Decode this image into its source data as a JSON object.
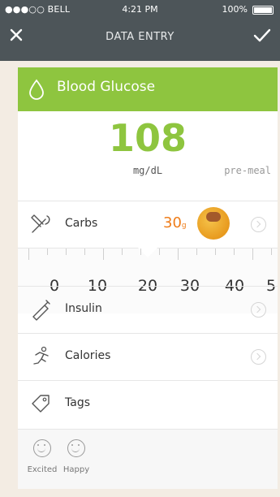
{
  "status": {
    "carrier": "●●●○○ BELL",
    "time": "4:21 PM",
    "battery": "100%"
  },
  "nav": {
    "title": "DATA ENTRY"
  },
  "glucose": {
    "title": "Blood Glucose",
    "value": "108",
    "unit": "mg/dL",
    "meal_tag": "pre-meal",
    "accent": "#8ec53f"
  },
  "carbs": {
    "label": "Carbs",
    "value": "30",
    "unit": "g",
    "accent": "#ef7d1a"
  },
  "ruler": {
    "numbers": [
      "0",
      "10",
      "20",
      "30",
      "40",
      "5"
    ]
  },
  "rows": {
    "insulin": "Insulin",
    "calories": "Calories",
    "tags": "Tags"
  },
  "moods": [
    {
      "label": "Excited"
    },
    {
      "label": "Happy"
    }
  ],
  "icons": [
    "close-icon",
    "checkmark-icon",
    "drop-icon",
    "fork-knife-icon",
    "syringe-icon",
    "runner-icon",
    "tag-icon",
    "chevron-right-icon"
  ]
}
